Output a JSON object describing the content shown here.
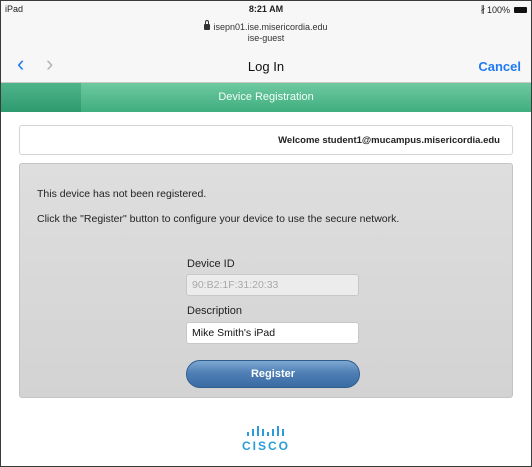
{
  "status_bar": {
    "device": "iPad",
    "time": "8:21 AM",
    "battery": "100%"
  },
  "url_bar": {
    "host": "isepn01.ise.misericordia.edu",
    "network": "ise-guest"
  },
  "nav": {
    "title": "Log In",
    "cancel_label": "Cancel"
  },
  "banner": {
    "title": "Device Registration"
  },
  "welcome": {
    "text": "Welcome student1@mucampus.misericordia.edu"
  },
  "panel": {
    "message1": "This device has not been registered.",
    "message2": "Click the \"Register\" button to configure your device to use the secure network.",
    "device_id_label": "Device ID",
    "device_id_value": "90:B2:1F:31:20:33",
    "description_label": "Description",
    "description_value": "Mike Smith's iPad",
    "register_label": "Register"
  },
  "footer": {
    "logo_word": "CISCO"
  },
  "colors": {
    "accent": "#1f7bf2",
    "banner_green": "#3fae7f",
    "button_blue": "#4f7fb5",
    "cisco_blue": "#2b9cd8"
  }
}
